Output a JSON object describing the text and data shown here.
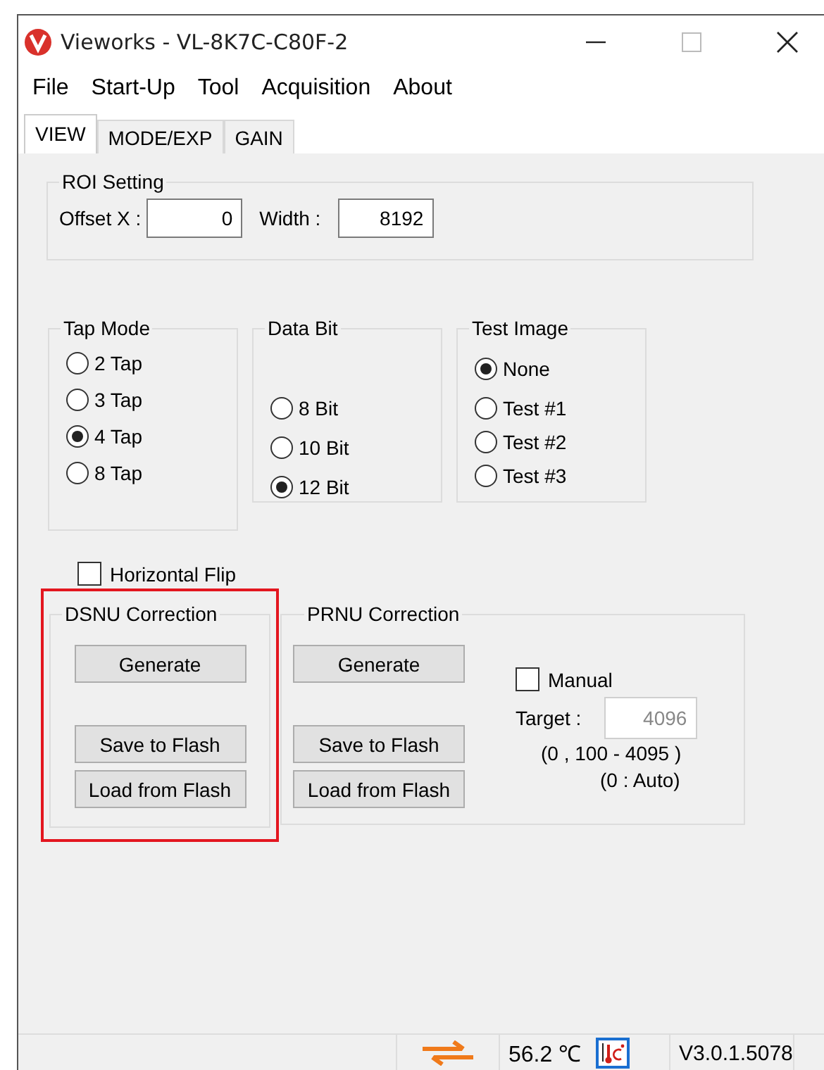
{
  "window": {
    "title": "Vieworks - VL-8K7C-C80F-2"
  },
  "menu": [
    {
      "label": "File"
    },
    {
      "label": "Start-Up"
    },
    {
      "label": "Tool"
    },
    {
      "label": "Acquisition"
    },
    {
      "label": "About"
    }
  ],
  "tabs": [
    {
      "label": "VIEW",
      "selected": true
    },
    {
      "label": "MODE/EXP",
      "selected": false
    },
    {
      "label": "GAIN",
      "selected": false
    }
  ],
  "roi": {
    "title": "ROI Setting",
    "offset_label": "Offset X :",
    "offset_value": "0",
    "width_label": "Width :",
    "width_value": "8192"
  },
  "radio_groups": [
    {
      "title": "Tap Mode",
      "options": [
        {
          "label": "2 Tap",
          "selected": false
        },
        {
          "label": "3 Tap",
          "selected": false
        },
        {
          "label": "4 Tap",
          "selected": true
        },
        {
          "label": "8 Tap",
          "selected": false
        }
      ]
    },
    {
      "title": "Data Bit",
      "options": [
        {
          "label": "8 Bit",
          "selected": false
        },
        {
          "label": "10 Bit",
          "selected": false
        },
        {
          "label": "12 Bit",
          "selected": true
        }
      ]
    },
    {
      "title": "Test Image",
      "options": [
        {
          "label": "None",
          "selected": true
        },
        {
          "label": "Test #1",
          "selected": false
        },
        {
          "label": "Test #2",
          "selected": false
        },
        {
          "label": "Test #3",
          "selected": false
        }
      ]
    }
  ],
  "horizontal_flip": {
    "label": "Horizontal Flip",
    "checked": false
  },
  "dsnu": {
    "title": "DSNU Correction",
    "highlighted": true,
    "buttons": [
      "Generate",
      "Save to Flash",
      "Load from Flash"
    ]
  },
  "prnu": {
    "title": "PRNU Correction",
    "buttons": [
      "Generate",
      "Save to Flash",
      "Load from Flash"
    ],
    "manual": {
      "label": "Manual",
      "checked": false
    },
    "target_label": "Target :",
    "target_value": "4096",
    "target_disabled": true,
    "range": "(0 , 100 - 4095 )",
    "auto_note": "(0 : Auto)"
  },
  "status_bar": {
    "temperature": "56.2 ℃",
    "version": "V3.0.1.5078"
  }
}
